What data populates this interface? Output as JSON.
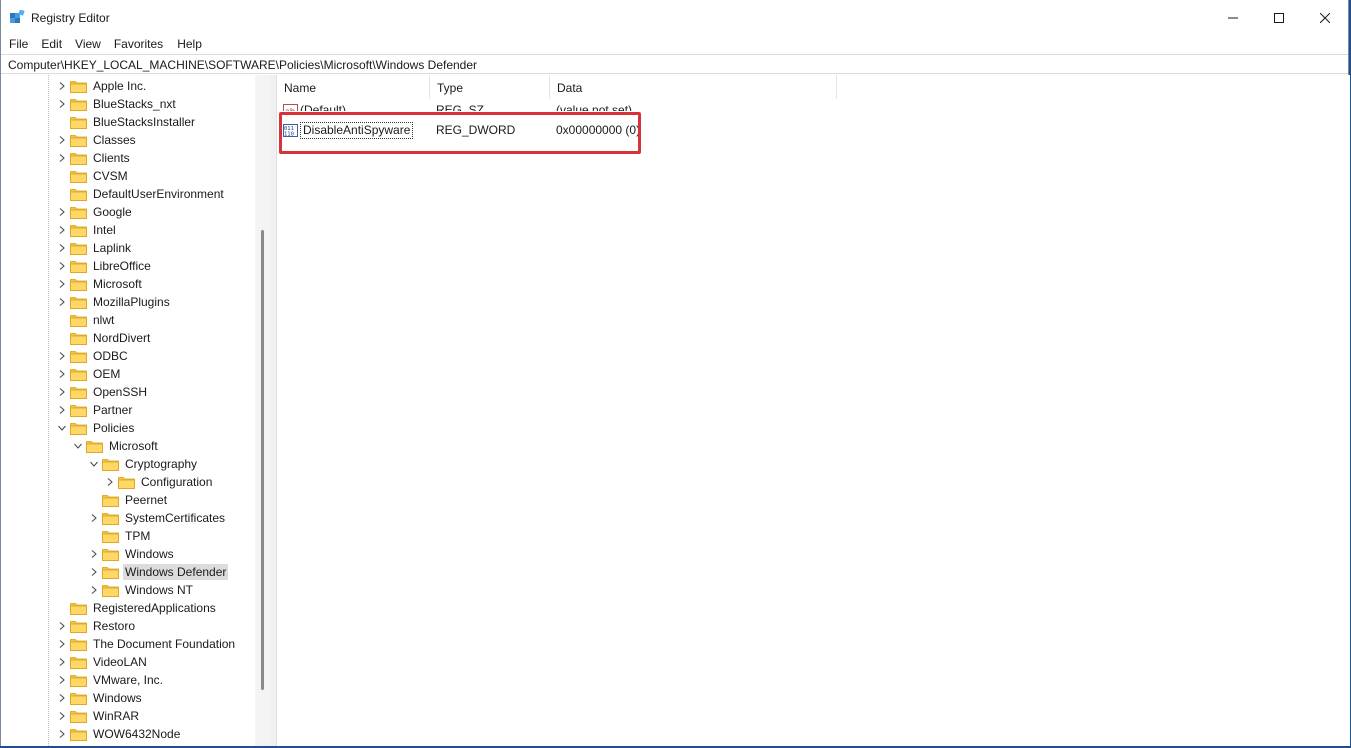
{
  "window": {
    "title": "Registry Editor",
    "controls": {
      "minimize": "minimize",
      "maximize": "maximize",
      "close": "close"
    }
  },
  "menu": [
    "File",
    "Edit",
    "View",
    "Favorites",
    "Help"
  ],
  "address": "Computer\\HKEY_LOCAL_MACHINE\\SOFTWARE\\Policies\\Microsoft\\Windows Defender",
  "tree": [
    {
      "label": "Apple Inc.",
      "depth": 0,
      "expander": "collapsed"
    },
    {
      "label": "BlueStacks_nxt",
      "depth": 0,
      "expander": "collapsed"
    },
    {
      "label": "BlueStacksInstaller",
      "depth": 0,
      "expander": "none"
    },
    {
      "label": "Classes",
      "depth": 0,
      "expander": "collapsed"
    },
    {
      "label": "Clients",
      "depth": 0,
      "expander": "collapsed"
    },
    {
      "label": "CVSM",
      "depth": 0,
      "expander": "none"
    },
    {
      "label": "DefaultUserEnvironment",
      "depth": 0,
      "expander": "none"
    },
    {
      "label": "Google",
      "depth": 0,
      "expander": "collapsed"
    },
    {
      "label": "Intel",
      "depth": 0,
      "expander": "collapsed"
    },
    {
      "label": "Laplink",
      "depth": 0,
      "expander": "collapsed"
    },
    {
      "label": "LibreOffice",
      "depth": 0,
      "expander": "collapsed"
    },
    {
      "label": "Microsoft",
      "depth": 0,
      "expander": "collapsed"
    },
    {
      "label": "MozillaPlugins",
      "depth": 0,
      "expander": "collapsed"
    },
    {
      "label": "nlwt",
      "depth": 0,
      "expander": "none"
    },
    {
      "label": "NordDivert",
      "depth": 0,
      "expander": "none"
    },
    {
      "label": "ODBC",
      "depth": 0,
      "expander": "collapsed"
    },
    {
      "label": "OEM",
      "depth": 0,
      "expander": "collapsed"
    },
    {
      "label": "OpenSSH",
      "depth": 0,
      "expander": "collapsed"
    },
    {
      "label": "Partner",
      "depth": 0,
      "expander": "collapsed"
    },
    {
      "label": "Policies",
      "depth": 0,
      "expander": "expanded"
    },
    {
      "label": "Microsoft",
      "depth": 1,
      "expander": "expanded"
    },
    {
      "label": "Cryptography",
      "depth": 2,
      "expander": "expanded"
    },
    {
      "label": "Configuration",
      "depth": 3,
      "expander": "collapsed"
    },
    {
      "label": "Peernet",
      "depth": 2,
      "expander": "none"
    },
    {
      "label": "SystemCertificates",
      "depth": 2,
      "expander": "collapsed"
    },
    {
      "label": "TPM",
      "depth": 2,
      "expander": "none"
    },
    {
      "label": "Windows",
      "depth": 2,
      "expander": "collapsed"
    },
    {
      "label": "Windows Defender",
      "depth": 2,
      "expander": "collapsed",
      "selected": true
    },
    {
      "label": "Windows NT",
      "depth": 2,
      "expander": "collapsed"
    },
    {
      "label": "RegisteredApplications",
      "depth": 0,
      "expander": "none"
    },
    {
      "label": "Restoro",
      "depth": 0,
      "expander": "collapsed"
    },
    {
      "label": "The Document Foundation",
      "depth": 0,
      "expander": "collapsed"
    },
    {
      "label": "VideoLAN",
      "depth": 0,
      "expander": "collapsed"
    },
    {
      "label": "VMware, Inc.",
      "depth": 0,
      "expander": "collapsed"
    },
    {
      "label": "Windows",
      "depth": 0,
      "expander": "collapsed"
    },
    {
      "label": "WinRAR",
      "depth": 0,
      "expander": "collapsed"
    },
    {
      "label": "WOW6432Node",
      "depth": 0,
      "expander": "collapsed"
    }
  ],
  "list": {
    "columns": {
      "name": "Name",
      "type": "Type",
      "data": "Data"
    },
    "rows": [
      {
        "name": "(Default)",
        "type": "REG_SZ",
        "data": "(value not set)",
        "icon": "string-value-icon"
      },
      {
        "name": "DisableAntiSpyware",
        "type": "REG_DWORD",
        "data": "0x00000000 (0)",
        "icon": "dword-value-icon",
        "editing": true
      }
    ]
  },
  "colors": {
    "highlight": "#d6333a",
    "folder": "#f5c242",
    "selection": "#dcdcdc"
  }
}
